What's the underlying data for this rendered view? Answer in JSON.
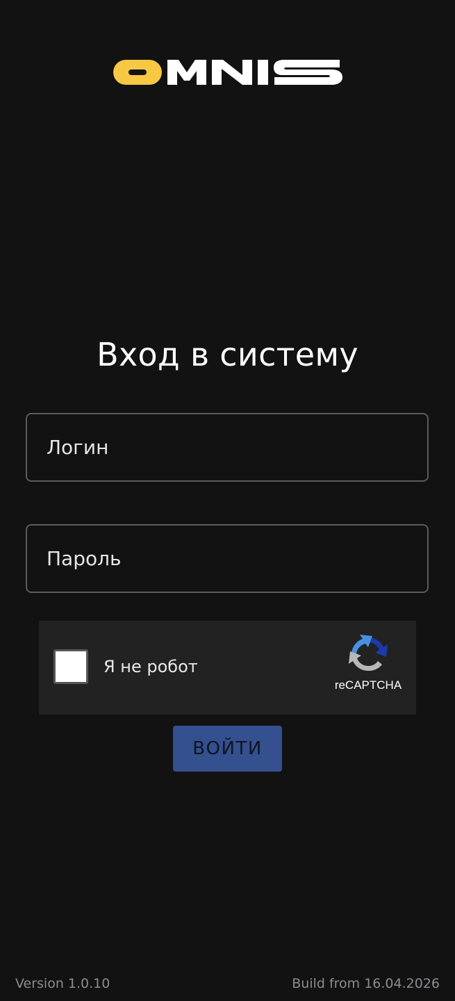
{
  "logo": {
    "text": "OMNIS",
    "accent_color": "#f7c844",
    "text_color": "#ffffff"
  },
  "title": "Вход в систему",
  "form": {
    "login_placeholder": "Логин",
    "password_placeholder": "Пароль",
    "submit_label": "ВОЙТИ"
  },
  "captcha": {
    "label": "Я не робот",
    "brand": "reCAPTCHA",
    "icon": "recaptcha-icon"
  },
  "footer": {
    "version": "Version 1.0.10",
    "build": "Build from 16.04.2026"
  },
  "colors": {
    "background": "#121213",
    "button": "#34508f",
    "captcha_bg": "#222223",
    "field_border": "#5b5b5e"
  }
}
